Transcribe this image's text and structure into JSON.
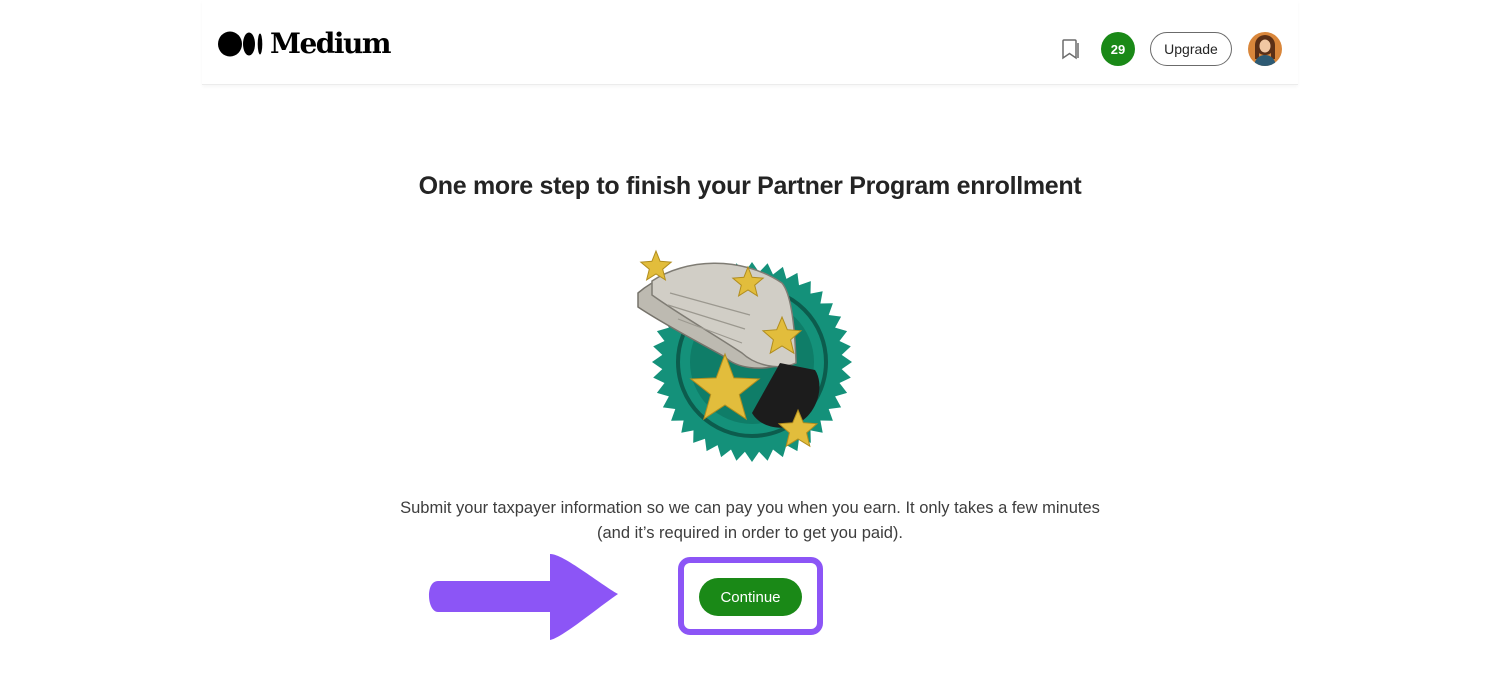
{
  "header": {
    "logo_text": "Medium",
    "notification_count": "29",
    "upgrade_label": "Upgrade"
  },
  "main": {
    "title": "One more step to finish your Partner Program enrollment",
    "description": "Submit your taxpayer information so we can pay you when you earn. It only takes a few minutes (and it’s required in order to get you paid).",
    "continue_label": "Continue"
  },
  "colors": {
    "brand_green": "#1a8917",
    "badge_teal": "#14917a",
    "annotation_purple": "#8c55f6",
    "star_gold": "#e2bd3c"
  },
  "icons": [
    "medium-logo-icon",
    "bookmark-icon",
    "avatar",
    "clapping-hands-badge-illustration",
    "arrow-annotation"
  ]
}
